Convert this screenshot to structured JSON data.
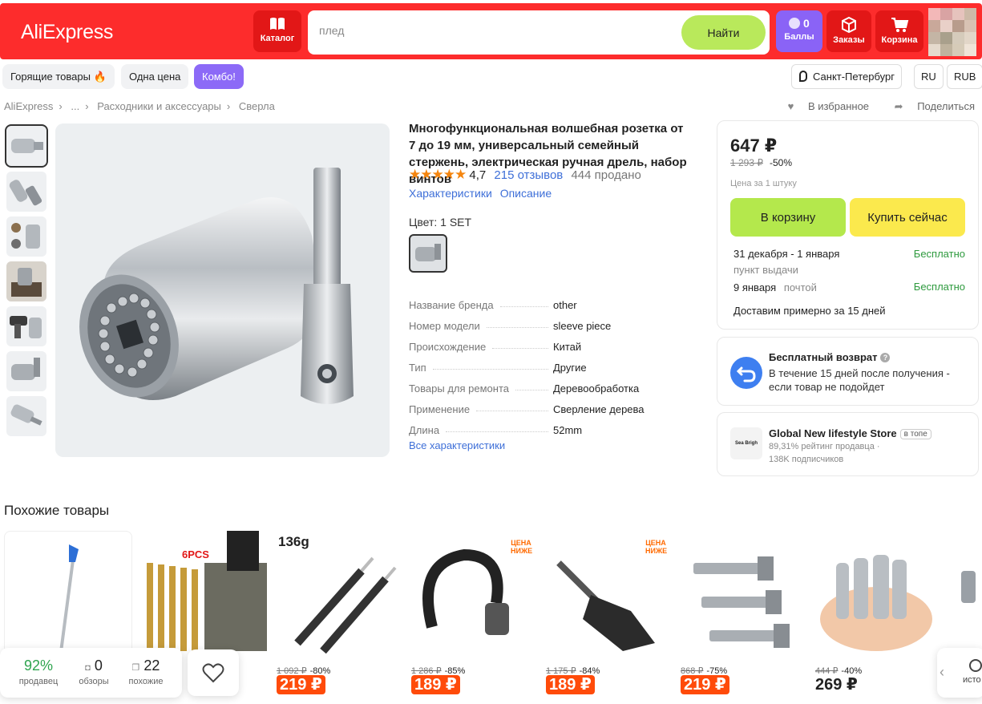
{
  "header": {
    "logo": "AliExpress",
    "catalog_label": "Каталог",
    "search_placeholder": "плед",
    "find_label": "Найти",
    "points_count": "0",
    "points_label": "Баллы",
    "orders_label": "Заказы",
    "cart_label": "Корзина"
  },
  "tags": [
    "Горящие товары 🔥",
    "Одна цена",
    "Комбо!"
  ],
  "location": {
    "city": "Санкт-Петербург",
    "lang": "RU",
    "currency": "RUB"
  },
  "breadcrumb": [
    "AliExpress",
    "...",
    "Расходники и аксессуары",
    "Сверла"
  ],
  "actions": {
    "favorite": "В избранное",
    "share": "Поделиться"
  },
  "product": {
    "title": "Многофункциональная волшебная розетка от 7 до 19 мм, универсальный семейный стержень, электрическая ручная дрель, набор винтов",
    "stars": "★★★★★",
    "rating": "4,7",
    "reviews": "215 отзывов",
    "sold": "444 продано",
    "link_specs": "Характеристики",
    "link_desc": "Описание",
    "color_label": "Цвет: 1 SET",
    "specs": [
      {
        "k": "Название бренда",
        "v": "other"
      },
      {
        "k": "Номер модели",
        "v": "sleeve piece"
      },
      {
        "k": "Происхождение",
        "v": "Китай"
      },
      {
        "k": "Тип",
        "v": "Другие"
      },
      {
        "k": "Товары для ремонта",
        "v": "Деревообработка"
      },
      {
        "k": "Применение",
        "v": "Сверление дерева"
      },
      {
        "k": "Длина",
        "v": "52mm"
      }
    ],
    "all_specs": "Все характеристики"
  },
  "buy": {
    "price": "647 ₽",
    "old_price": "1 293 ₽",
    "discount": "-50%",
    "per_unit": "Цена за 1 штуку",
    "to_cart": "В корзину",
    "buy_now": "Купить сейчас",
    "delivery1_date": "31 декабря - 1 января",
    "delivery1_where": "пункт выдачи",
    "delivery1_price": "Бесплатно",
    "delivery2_date": "9 января",
    "delivery2_where": "почтой",
    "delivery2_price": "Бесплатно",
    "eta": "Доставим примерно за 15 дней"
  },
  "return": {
    "title": "Бесплатный возврат",
    "text": "В течение 15 дней после получения - если товар не подойдет"
  },
  "store": {
    "logo_text": "Sea Brigh",
    "name": "Global New lifestyle Store",
    "badge": "в топе",
    "rating": "89,31% рейтинг продавца",
    "subs": "138K подписчиков"
  },
  "similar": {
    "title": "Похожие товары",
    "cards": [
      {
        "old": "",
        "disc": "",
        "price": "",
        "plain": false,
        "badge": "",
        "label": ""
      },
      {
        "old": "",
        "disc": "",
        "price": "",
        "plain": false,
        "badge": "",
        "label": "6PCS"
      },
      {
        "old": "1 092 ₽",
        "disc": "-80%",
        "price": "219 ₽",
        "plain": false,
        "badge": "",
        "label": "136g"
      },
      {
        "old": "1 286 ₽",
        "disc": "-85%",
        "price": "189 ₽",
        "plain": false,
        "badge": "ЦЕНА НИЖЕ",
        "label": ""
      },
      {
        "old": "1 175 ₽",
        "disc": "-84%",
        "price": "189 ₽",
        "plain": false,
        "badge": "ЦЕНА НИЖЕ",
        "label": ""
      },
      {
        "old": "868 ₽",
        "disc": "-75%",
        "price": "219 ₽",
        "plain": false,
        "badge": "",
        "label": ""
      },
      {
        "old": "444 ₽",
        "disc": "-40%",
        "price": "269 ₽",
        "plain": true,
        "badge": "",
        "label": ""
      }
    ]
  },
  "floatbar": {
    "pct": "92%",
    "pct_label": "продавец",
    "reviews": "0",
    "reviews_label": "обзоры",
    "similar": "22",
    "similar_label": "похожие",
    "history_label": "исто"
  },
  "colors": {
    "brand_red": "#fd2c2c",
    "green_btn": "#b4e84c",
    "yellow_btn": "#fbe94d",
    "purple": "#8c6af7",
    "price_orange": "#ff4b0a"
  }
}
